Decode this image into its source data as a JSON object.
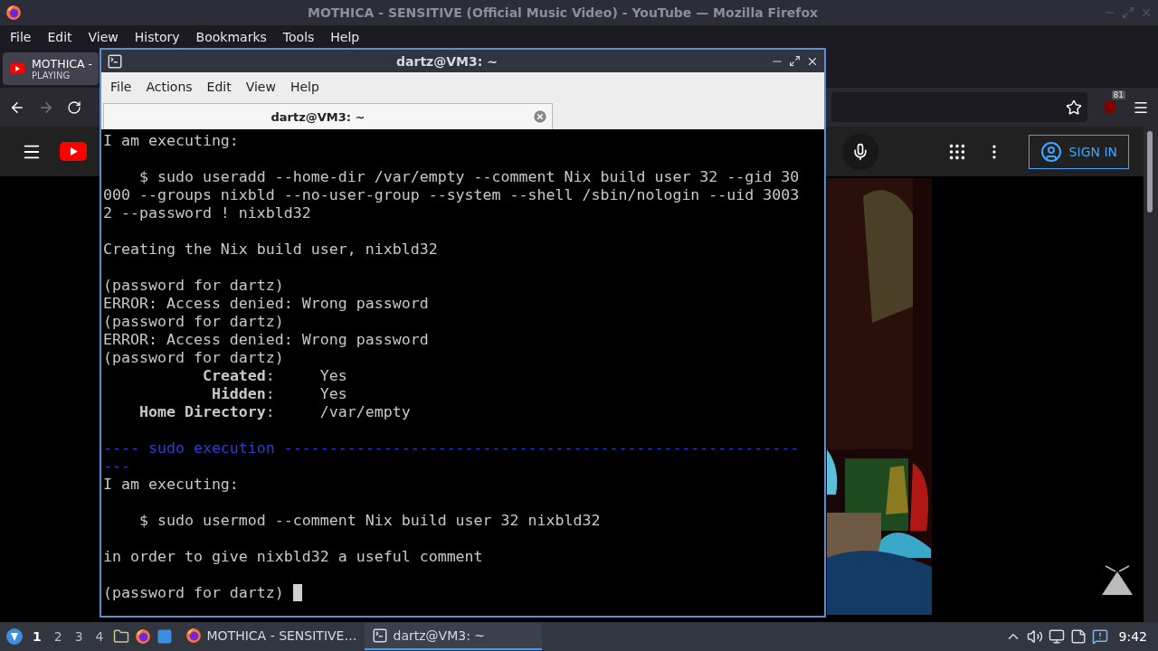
{
  "firefox": {
    "title": "MOTHICA - SENSITIVE (Official Music Video) - YouTube — Mozilla Firefox",
    "menu": [
      "File",
      "Edit",
      "View",
      "History",
      "Bookmarks",
      "Tools",
      "Help"
    ],
    "tab": {
      "title": "MOTHICA -",
      "status": "PLAYING"
    },
    "addon_badge": "81",
    "youtube": {
      "sign_in": "SIGN IN"
    }
  },
  "terminal": {
    "title": "dartz@VM3: ~",
    "menu": [
      "File",
      "Actions",
      "Edit",
      "View",
      "Help"
    ],
    "tabs": [
      {
        "label": "dartz@VM3: ~",
        "selected": true
      }
    ],
    "lines": [
      {
        "kind": "text",
        "text": "I am executing:"
      },
      {
        "kind": "blank"
      },
      {
        "kind": "text",
        "text": "    $ sudo useradd --home-dir /var/empty --comment Nix build user 32 --gid 30"
      },
      {
        "kind": "text",
        "text": "000 --groups nixbld --no-user-group --system --shell /sbin/nologin --uid 3003"
      },
      {
        "kind": "text",
        "text": "2 --password ! nixbld32"
      },
      {
        "kind": "blank"
      },
      {
        "kind": "text",
        "text": "Creating the Nix build user, nixbld32"
      },
      {
        "kind": "blank"
      },
      {
        "kind": "text",
        "text": "(password for dartz)"
      },
      {
        "kind": "text",
        "text": "ERROR: Access denied: Wrong password"
      },
      {
        "kind": "text",
        "text": "(password for dartz)"
      },
      {
        "kind": "text",
        "text": "ERROR: Access denied: Wrong password"
      },
      {
        "kind": "text",
        "text": "(password for dartz)"
      },
      {
        "kind": "text",
        "text": "           **Created**:     Yes"
      },
      {
        "kind": "text",
        "text": "            **Hidden**:     Yes"
      },
      {
        "kind": "text",
        "text": "    **Home Directory**:     /var/empty"
      },
      {
        "kind": "blank"
      },
      {
        "kind": "rule",
        "text": "---- sudo execution ---------------------------------------------------------"
      },
      {
        "kind": "rule",
        "text": "---"
      },
      {
        "kind": "text",
        "text": "I am executing:"
      },
      {
        "kind": "blank"
      },
      {
        "kind": "text",
        "text": "    $ sudo usermod --comment Nix build user 32 nixbld32"
      },
      {
        "kind": "blank"
      },
      {
        "kind": "text",
        "text": "in order to give nixbld32 a useful comment"
      },
      {
        "kind": "blank"
      },
      {
        "kind": "prompt",
        "text": "(password for dartz) "
      }
    ]
  },
  "taskbar": {
    "workspaces": [
      {
        "label": "1",
        "selected": true
      },
      {
        "label": "2",
        "selected": false
      },
      {
        "label": "3",
        "selected": false
      },
      {
        "label": "4",
        "selected": false
      }
    ],
    "tasks": [
      {
        "kind": "browser",
        "label": "MOTHICA - SENSITIVE…",
        "selected": false
      },
      {
        "kind": "terminal",
        "label": "dartz@VM3: ~",
        "selected": true
      }
    ],
    "clock": "9:42"
  }
}
